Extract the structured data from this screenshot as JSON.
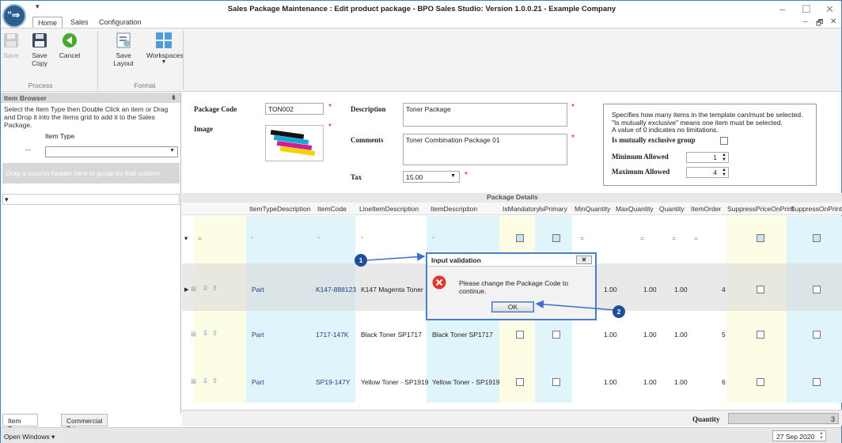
{
  "window": {
    "title": "Sales Package Maintenance : Edit product package - BPO Sales Studio: Version 1.0.0.21 - Example Company",
    "qat_symbol": "▾",
    "min": "–",
    "max": "☐",
    "close": "✕"
  },
  "ribbon": {
    "tabs": [
      "Home",
      "Sales",
      "Configuration"
    ],
    "right_controls": [
      "–",
      "🗗",
      "✕"
    ],
    "buttons": [
      "Save",
      "Save Copy",
      "Cancel",
      "Save Layout",
      "Workspaces"
    ],
    "groups": [
      "Process",
      "Format"
    ]
  },
  "item_browser": {
    "title": "Item Browser",
    "pin": "⇟",
    "description": "Select the Item Type then Double Click an item or Drag and Drop it into the items grid to add it to the Sales Package.",
    "item_type_label": "Item Type",
    "dots": "...",
    "group_hint": "Drag a column header here to group by that column",
    "filter_symbol": "▾",
    "tabs": [
      "Item Browser",
      "Commercial Prices"
    ]
  },
  "form": {
    "package_code_label": "Package Code",
    "package_code": "TON002",
    "image_label": "Image",
    "description_label": "Description",
    "description": "Toner Package",
    "comments_label": "Comments",
    "comments": "Toner Combination Package 01",
    "tax_label": "Tax",
    "tax": "15.00",
    "required_mark": "*"
  },
  "info_box": {
    "line1": "Specifies how many items in the template can/must be selected.",
    "line2": "\"Is mutually exclusive\" means one item must be selected.",
    "line3": "A value of 0 indicates no limitations.",
    "mutually_label": "Is mutually exclusive group",
    "min_label": "Minimum Allowed",
    "min_value": "1",
    "max_label": "Maximum Allowed",
    "max_value": "4"
  },
  "grid": {
    "title": "Package Details",
    "columns": [
      "ItemTypeDescription",
      "ItemCode",
      "LineItemDescription",
      "ItemDescription",
      "IsMandatory",
      "IsPrimary",
      "MinQuantity",
      "MaxQuantity",
      "Quantity",
      "ItemOrder",
      "SuppressPriceOnPrint",
      "SuppressOnPrint"
    ],
    "new_row_symbol": "=",
    "rows": [
      {
        "type": "Part",
        "code": "K147-888123",
        "line": "K147 Magenta Toner",
        "desc": "",
        "min": "1.00",
        "max": "1.00",
        "qty": "1.00",
        "order": "4"
      },
      {
        "type": "Part",
        "code": "1717-147K",
        "line": "Black Toner SP1717",
        "desc": "Black Toner SP1717",
        "min": "1.00",
        "max": "1.00",
        "qty": "1.00",
        "order": "5"
      },
      {
        "type": "Part",
        "code": "SP19-147Y",
        "line": "Yellow Toner - SP1919",
        "desc": "Yellow Toner - SP1919",
        "min": "1.00",
        "max": "1.00",
        "qty": "1.00",
        "order": "6"
      }
    ],
    "quantity_label": "Quantity",
    "quantity_total": "3"
  },
  "dialog": {
    "title": "Input validation",
    "message": "Please change the Package Code to continue.",
    "ok": "OK",
    "close": "✕"
  },
  "callouts": [
    "1",
    "2"
  ],
  "status": {
    "open_windows": "Open Windows ▾",
    "date": "27 Sep 2020"
  },
  "colors": {
    "accent": "#1d4f9a",
    "yellow_col": "#fdfde6",
    "cyan_col": "#e0f5fb",
    "selected_row": "#f0f0f0"
  }
}
